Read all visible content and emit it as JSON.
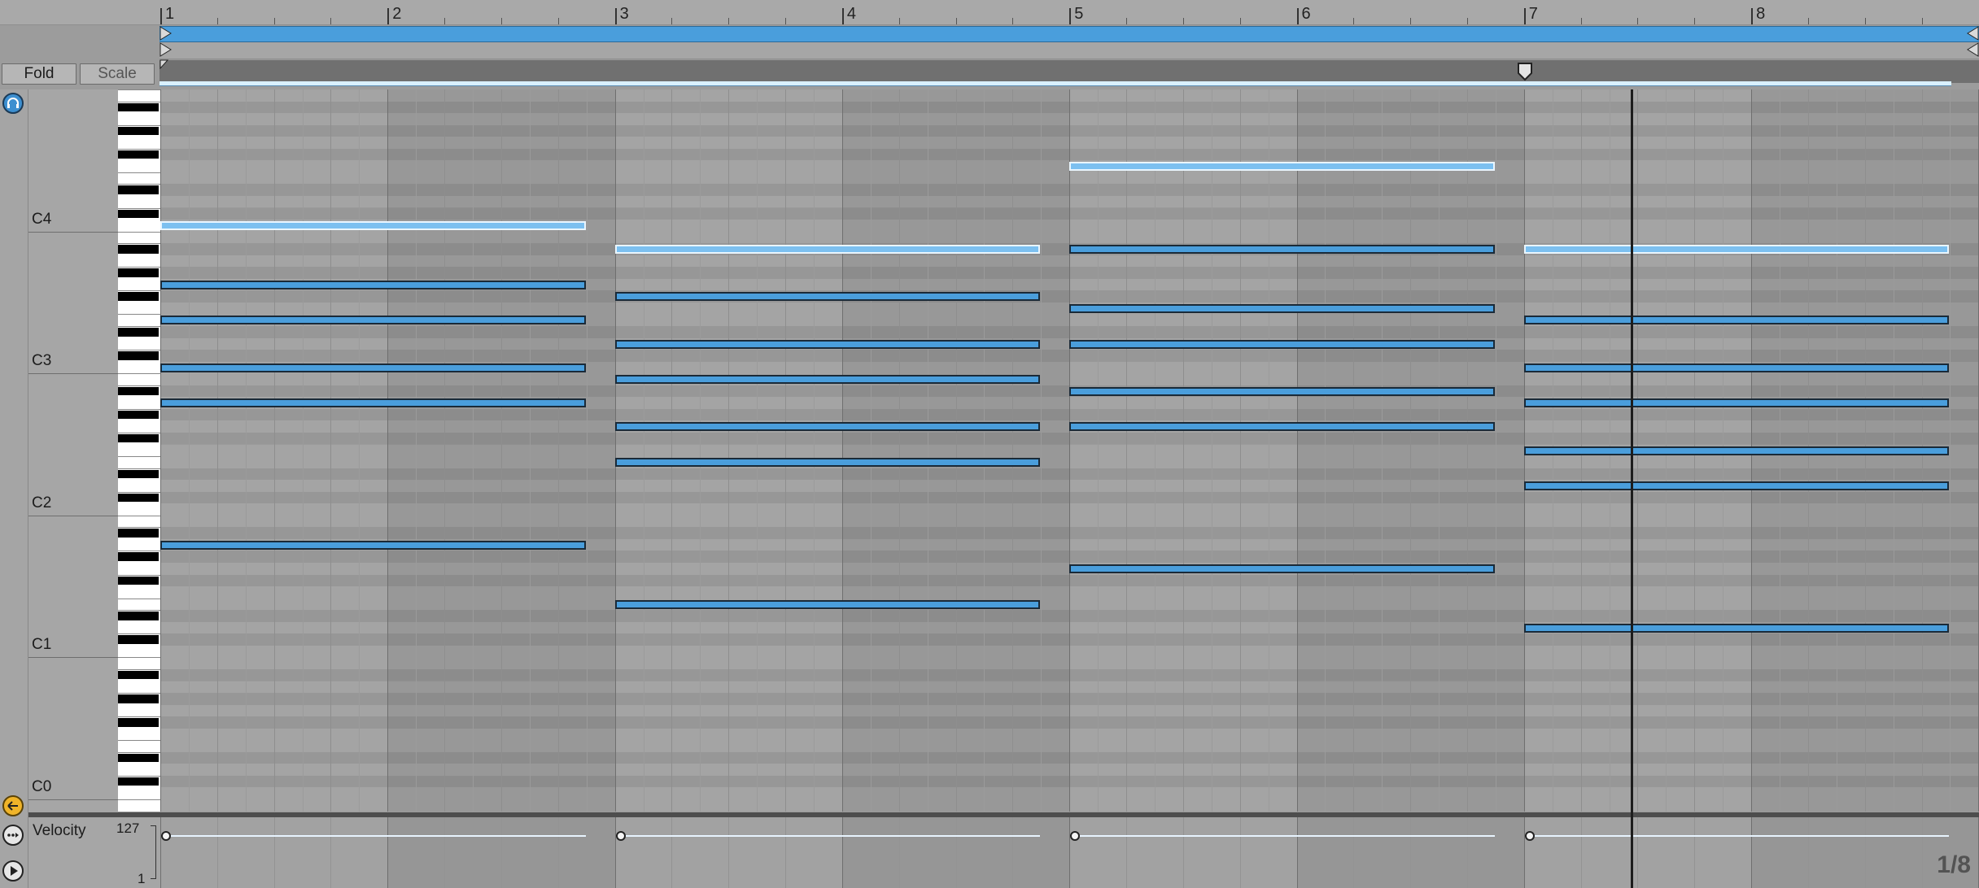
{
  "toolbar": {
    "fold_label": "Fold",
    "scale_label": "Scale"
  },
  "ruler": {
    "bars": [
      "1",
      "2",
      "3",
      "4",
      "5",
      "6",
      "7",
      "8"
    ]
  },
  "keyboard": {
    "octave_labels": [
      "C4",
      "C3",
      "C2",
      "C1",
      "C0"
    ]
  },
  "velocity": {
    "label": "Velocity",
    "max": "127",
    "min": "1"
  },
  "grid": {
    "quantize": "1/8"
  },
  "colors": {
    "note": "#4a9edc",
    "note_selected": "#7cc0f0",
    "loop": "#4a9edc",
    "accent": "#f0b429"
  },
  "icons": {
    "headphones": "headphones-icon",
    "back": "arrow-left-icon",
    "more": "more-icon",
    "play": "play-icon"
  },
  "notes": [
    {
      "bar": 1,
      "len": 2,
      "pitch": 60,
      "sel": true
    },
    {
      "bar": 1,
      "len": 2,
      "pitch": 55,
      "sel": false
    },
    {
      "bar": 1,
      "len": 2,
      "pitch": 52,
      "sel": false
    },
    {
      "bar": 1,
      "len": 2,
      "pitch": 48,
      "sel": false
    },
    {
      "bar": 1,
      "len": 2,
      "pitch": 45,
      "sel": false
    },
    {
      "bar": 1,
      "len": 2,
      "pitch": 33,
      "sel": false
    },
    {
      "bar": 3,
      "len": 2,
      "pitch": 58,
      "sel": true
    },
    {
      "bar": 3,
      "len": 2,
      "pitch": 54,
      "sel": false
    },
    {
      "bar": 3,
      "len": 2,
      "pitch": 50,
      "sel": false
    },
    {
      "bar": 3,
      "len": 2,
      "pitch": 47,
      "sel": false
    },
    {
      "bar": 3,
      "len": 2,
      "pitch": 43,
      "sel": false
    },
    {
      "bar": 3,
      "len": 2,
      "pitch": 40,
      "sel": false
    },
    {
      "bar": 3,
      "len": 2,
      "pitch": 28,
      "sel": false
    },
    {
      "bar": 5,
      "len": 2,
      "pitch": 65,
      "sel": true
    },
    {
      "bar": 5,
      "len": 2,
      "pitch": 58,
      "sel": false
    },
    {
      "bar": 5,
      "len": 2,
      "pitch": 53,
      "sel": false
    },
    {
      "bar": 5,
      "len": 2,
      "pitch": 50,
      "sel": false
    },
    {
      "bar": 5,
      "len": 2,
      "pitch": 46,
      "sel": false
    },
    {
      "bar": 5,
      "len": 2,
      "pitch": 43,
      "sel": false
    },
    {
      "bar": 5,
      "len": 2,
      "pitch": 31,
      "sel": false
    },
    {
      "bar": 7,
      "len": 2,
      "pitch": 58,
      "sel": true
    },
    {
      "bar": 7,
      "len": 2,
      "pitch": 52,
      "sel": false
    },
    {
      "bar": 7,
      "len": 2,
      "pitch": 48,
      "sel": false
    },
    {
      "bar": 7,
      "len": 2,
      "pitch": 45,
      "sel": false
    },
    {
      "bar": 7,
      "len": 2,
      "pitch": 41,
      "sel": false
    },
    {
      "bar": 7,
      "len": 2,
      "pitch": 38,
      "sel": false
    },
    {
      "bar": 7,
      "len": 2,
      "pitch": 26,
      "sel": false
    }
  ],
  "velocities": [
    {
      "bar": 1,
      "len": 2,
      "value": 127
    },
    {
      "bar": 3,
      "len": 2,
      "value": 127
    },
    {
      "bar": 5,
      "len": 2,
      "value": 127
    },
    {
      "bar": 7,
      "len": 2,
      "value": 127
    }
  ],
  "playhead_bar": 7.47
}
